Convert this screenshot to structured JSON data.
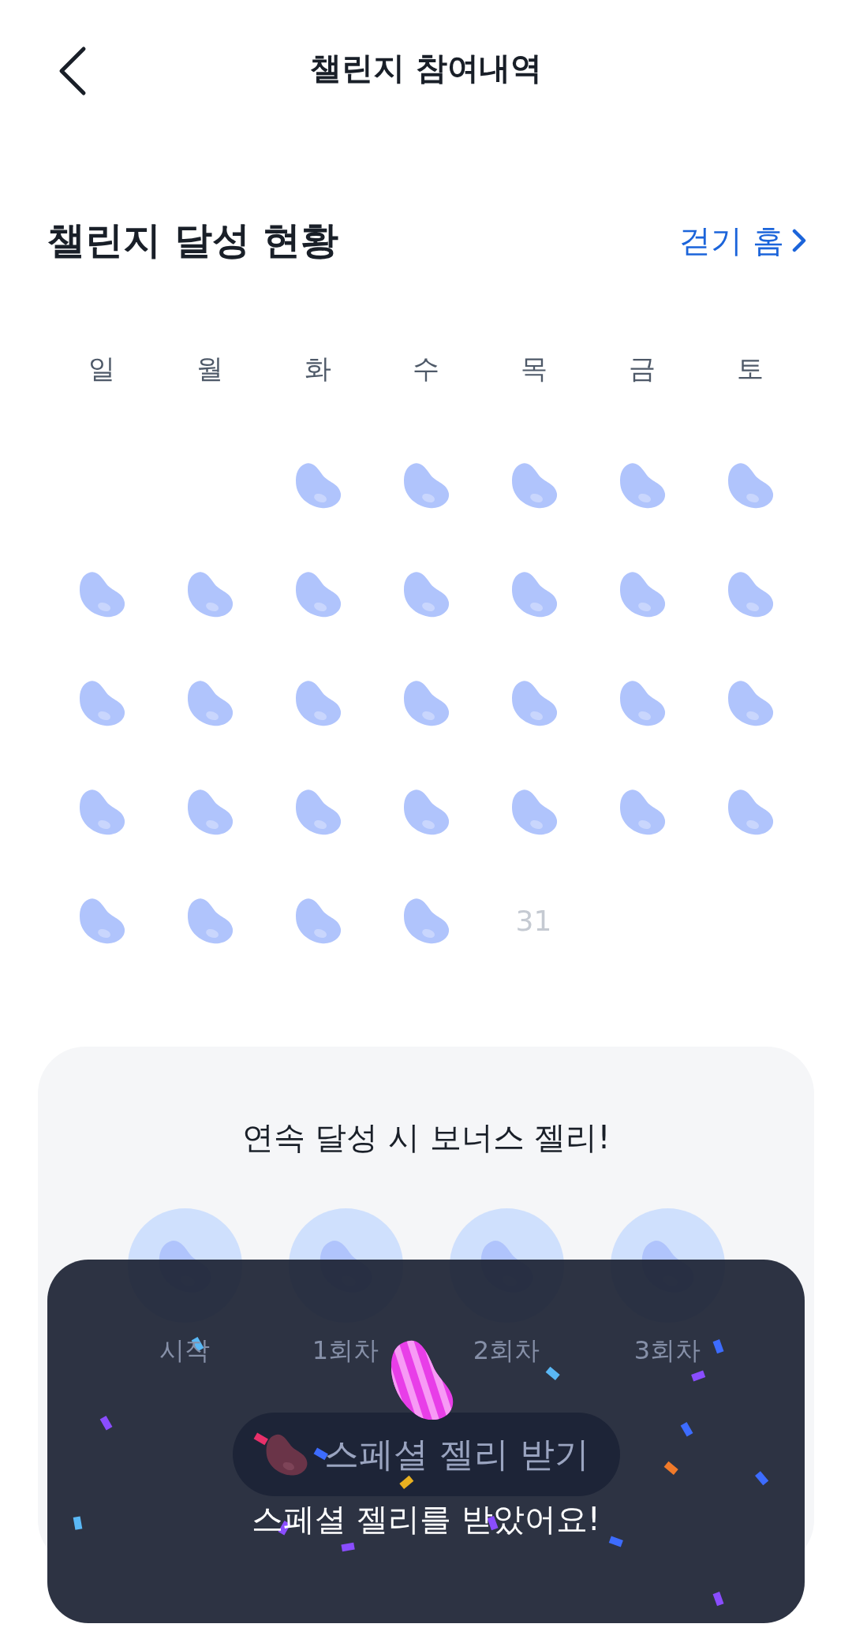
{
  "header": {
    "title": "챌린지 참여내역"
  },
  "section": {
    "title": "챌린지 달성 현황",
    "link": "걷기 홈"
  },
  "calendar": {
    "weekdays": [
      "일",
      "월",
      "화",
      "수",
      "목",
      "금",
      "토"
    ],
    "weeks": [
      [
        {
          "kind": "blank"
        },
        {
          "kind": "blank"
        },
        {
          "kind": "jelly"
        },
        {
          "kind": "jelly"
        },
        {
          "kind": "jelly"
        },
        {
          "kind": "jelly"
        },
        {
          "kind": "jelly"
        }
      ],
      [
        {
          "kind": "jelly"
        },
        {
          "kind": "jelly"
        },
        {
          "kind": "jelly"
        },
        {
          "kind": "jelly"
        },
        {
          "kind": "jelly"
        },
        {
          "kind": "jelly"
        },
        {
          "kind": "jelly"
        }
      ],
      [
        {
          "kind": "jelly"
        },
        {
          "kind": "jelly"
        },
        {
          "kind": "jelly"
        },
        {
          "kind": "jelly"
        },
        {
          "kind": "jelly"
        },
        {
          "kind": "jelly"
        },
        {
          "kind": "jelly"
        }
      ],
      [
        {
          "kind": "jelly"
        },
        {
          "kind": "jelly"
        },
        {
          "kind": "jelly"
        },
        {
          "kind": "jelly"
        },
        {
          "kind": "jelly"
        },
        {
          "kind": "jelly"
        },
        {
          "kind": "jelly"
        }
      ],
      [
        {
          "kind": "jelly"
        },
        {
          "kind": "jelly"
        },
        {
          "kind": "jelly"
        },
        {
          "kind": "jelly"
        },
        {
          "kind": "day",
          "label": "31"
        }
      ]
    ]
  },
  "bonus": {
    "title": "연속 달성 시 보너스 젤리!",
    "steps": [
      {
        "label": "시작"
      },
      {
        "label": "1회차"
      },
      {
        "label": "2회차"
      },
      {
        "label": "3회차"
      }
    ],
    "button": "스페셜 젤리 받기"
  },
  "toast": {
    "message": "스페셜 젤리를 받았어요!"
  }
}
